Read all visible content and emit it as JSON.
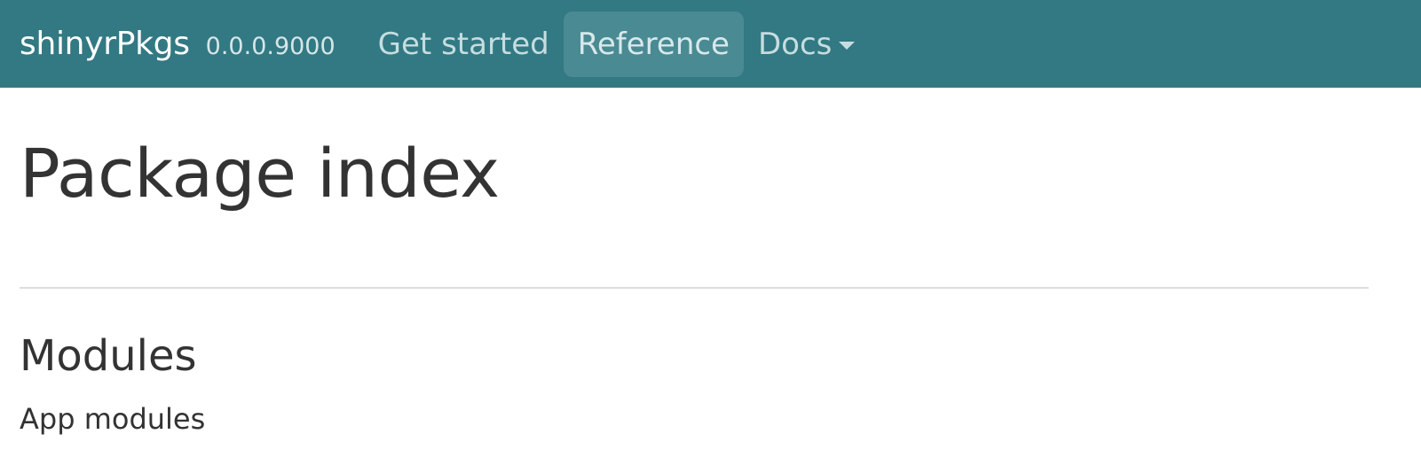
{
  "navbar": {
    "brand": "shinyrPkgs",
    "version": "0.0.0.9000",
    "items": [
      {
        "label": "Get started"
      },
      {
        "label": "Reference"
      },
      {
        "label": "Docs"
      }
    ],
    "colors": {
      "background": "#327983",
      "active_item": "#4a8a93"
    }
  },
  "main": {
    "title": "Package index",
    "section": {
      "title": "Modules",
      "subtitle": "App modules"
    }
  }
}
